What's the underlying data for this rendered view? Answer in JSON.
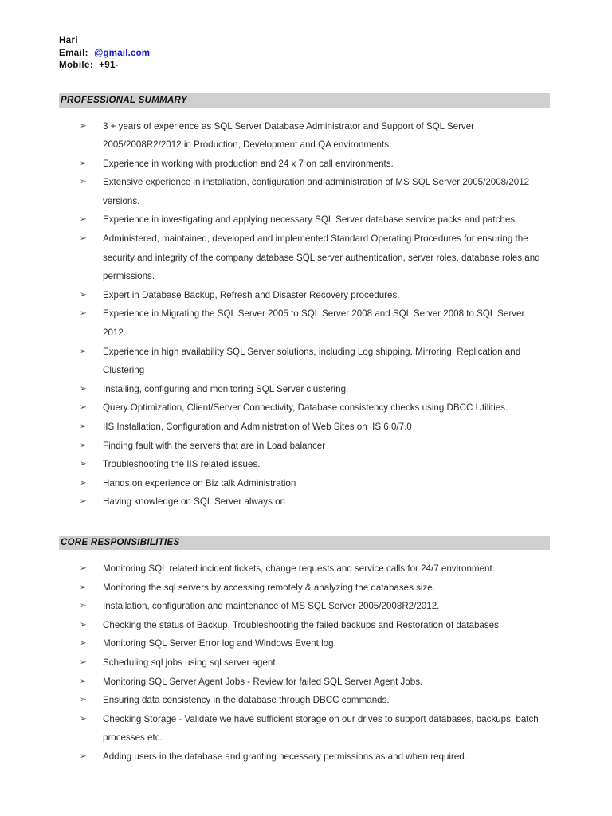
{
  "header": {
    "name": "Hari",
    "email_label": "Email:",
    "email_value": "@gmail.com",
    "mobile_label": "Mobile:",
    "mobile_value": "+91-"
  },
  "bullet_glyph": "➢",
  "colors": {
    "section_band": "#cfcfcf",
    "link": "#1414cf",
    "text": "#2b2b2b",
    "page_background": "#ffffff"
  },
  "sections": [
    {
      "title": "PROFESSIONAL SUMMARY",
      "bullets": [
        "3 + years of experience as SQL Server Database Administrator and Support of SQL Server 2005/2008R2/2012 in Production, Development and QA environments.",
        "Experience in working with production and 24 x 7 on call environments.",
        "Extensive experience in installation, configuration and administration of MS SQL Server 2005/2008/2012 versions.",
        "Experience in investigating and applying necessary SQL Server database service packs and patches.",
        "Administered, maintained, developed and implemented Standard Operating Procedures for ensuring the security and integrity of the company database SQL server authentication, server roles, database roles and permissions.",
        "Expert in Database Backup, Refresh and Disaster Recovery procedures.",
        "Experience in Migrating the SQL Server 2005 to SQL Server 2008 and SQL Server 2008 to SQL Server 2012.",
        "Experience in high availability SQL Server solutions, including Log shipping, Mirroring, Replication and Clustering",
        "Installing, configuring and monitoring SQL Server clustering.",
        "Query Optimization, Client/Server Connectivity, Database consistency checks using DBCC Utilities.",
        "IIS Installation, Configuration and Administration of Web Sites on IIS 6.0/7.0",
        "Finding fault with the servers that are in Load balancer",
        "Troubleshooting the IIS related issues.",
        "Hands on experience on Biz talk Administration",
        "Having knowledge on SQL Server always on"
      ]
    },
    {
      "title": "CORE RESPONSIBILITIES",
      "bullets": [
        "Monitoring SQL related incident tickets, change requests and service calls for 24/7 environment.",
        "Monitoring the sql servers by accessing remotely & analyzing the databases size.",
        "Installation, configuration and maintenance of MS SQL Server 2005/2008R2/2012.",
        "Checking the status of Backup, Troubleshooting the failed backups and Restoration of databases.",
        "Monitoring SQL Server Error log and Windows Event log.",
        "Scheduling sql jobs using sql server agent.",
        "Monitoring SQL Server Agent Jobs - Review for failed SQL Server Agent Jobs.",
        "Ensuring data consistency in the database through DBCC commands.",
        "Checking Storage - Validate we have sufficient storage on our drives to support databases, backups, batch processes etc.",
        "Adding users in the database and granting necessary permissions as and when required."
      ]
    }
  ]
}
